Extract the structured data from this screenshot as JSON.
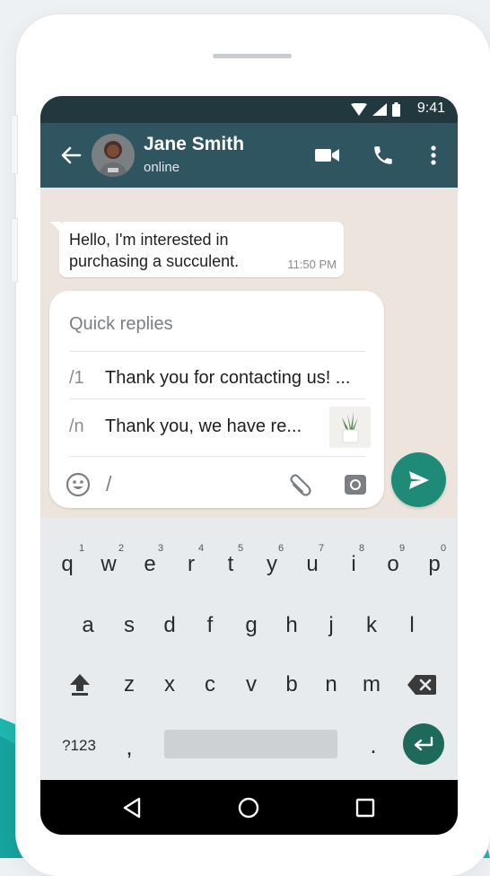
{
  "status_bar": {
    "time": "9:41"
  },
  "header": {
    "contact_name": "Jane Smith",
    "contact_status": "online"
  },
  "message": {
    "text": "Hello, I'm interested in purchasing a succulent.",
    "time": "11:50 PM"
  },
  "quick_replies": {
    "title": "Quick replies",
    "items": [
      {
        "shortcut": "/1",
        "text": "Thank you for contacting us! ..."
      },
      {
        "shortcut": "/n",
        "text": "Thank you, we have re..."
      }
    ]
  },
  "composer": {
    "value": "/"
  },
  "keyboard": {
    "row1": [
      "q",
      "w",
      "e",
      "r",
      "t",
      "y",
      "u",
      "i",
      "o",
      "p"
    ],
    "row1_hints": [
      "1",
      "2",
      "3",
      "4",
      "5",
      "6",
      "7",
      "8",
      "9",
      "0"
    ],
    "row2": [
      "a",
      "s",
      "d",
      "f",
      "g",
      "h",
      "j",
      "k",
      "l"
    ],
    "row3": [
      "z",
      "x",
      "c",
      "v",
      "b",
      "n",
      "m"
    ],
    "symbols_key": "?123",
    "comma_key": ",",
    "period_key": "."
  },
  "colors": {
    "status_bar": "#22383f",
    "app_bar": "#2f5561",
    "chat_background": "#ede5dd",
    "send_button": "#1e8a77",
    "keyboard": "#e7ebed",
    "teal_accent": "#1fb6b0"
  },
  "icons": {
    "header": [
      "back-arrow-icon",
      "video-call-icon",
      "phone-icon",
      "more-vertical-icon"
    ],
    "composer": [
      "emoji-icon",
      "attach-icon",
      "camera-icon",
      "send-icon"
    ],
    "nav": [
      "nav-back-icon",
      "nav-home-icon",
      "nav-recents-icon"
    ]
  }
}
